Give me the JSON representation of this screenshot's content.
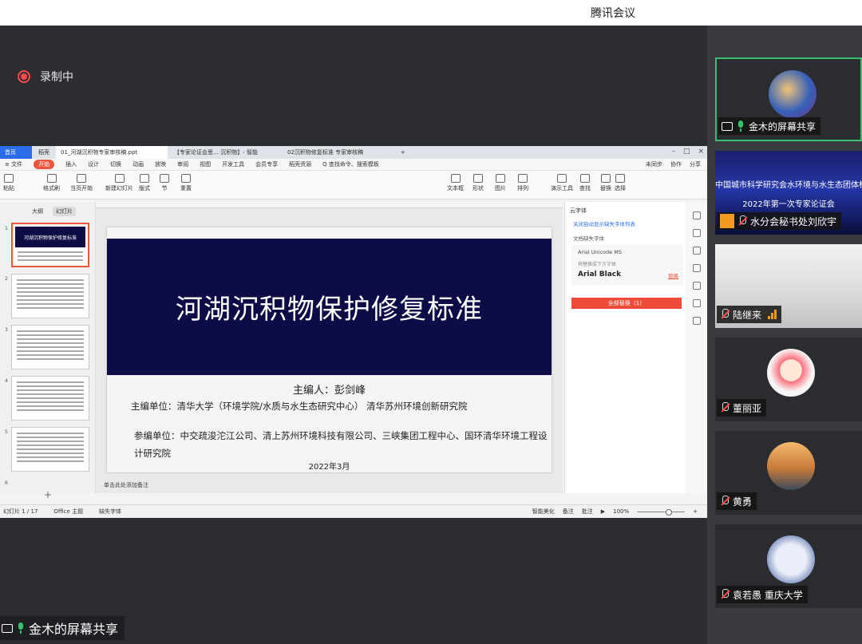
{
  "app": {
    "title": "腾讯会议",
    "recording": "录制中"
  },
  "wps": {
    "tabs": [
      "首页",
      "稻壳",
      "01_河湖沉积物专家审核稿.ppt",
      "【专家论证会思… 沉积物】- 智能",
      "02沉积物修复标准 专家审核稿"
    ],
    "menu": [
      "≡ 文件",
      "开始",
      "插入",
      "设计",
      "切换",
      "动画",
      "放映",
      "审阅",
      "视图",
      "开发工具",
      "会员专享",
      "稻壳资源",
      "Q 查找命令、搜索模板"
    ],
    "menu_right": [
      "未同步",
      "协作",
      "分享"
    ],
    "ribbon": [
      "粘贴",
      "格式刷",
      "当页开始",
      "新建幻灯片",
      "版式",
      "节",
      "重置",
      "文本框",
      "形状",
      "图片",
      "排列",
      "查找",
      "演示工具",
      "替换",
      "选择"
    ],
    "thumb_tabs": [
      "大纲",
      "幻灯片"
    ],
    "thumb_title": "河湖沉积物保护修复标准",
    "slide": {
      "title": "河湖沉积物保护修复标准",
      "editor": "主编人：彭剑峰",
      "org": "主编单位：清华大学（环境学院/水质与水生态研究中心）  清华苏州环境创新研究院",
      "participants": "参编单位：中交疏浚沱江公司、清上苏州环境科技有限公司、三峡集团工程中心、国环清华环境工程设计研究院",
      "date": "2022年3月"
    },
    "notes": "单击此处添加备注",
    "font_pane": {
      "title": "云字体",
      "link": "关闭自动显示缺失字体列表",
      "sub": "文档缺失字体",
      "missing": "Arial Unicode MS",
      "note": "将替换成下方字体",
      "font": "Arial Black",
      "install": "替换",
      "button": "全部替换（1）"
    },
    "status": {
      "slide": "幻灯片 1 / 17",
      "theme": "Office 主题",
      "missing_font": "缺失字体",
      "beautify": "智能美化",
      "notes": "备注",
      "comments": "批注",
      "zoom": "100%"
    }
  },
  "presenter_bottom": "金木的屏幕共享",
  "participants": [
    {
      "name": "金木的屏幕共享"
    },
    {
      "name": "水分会秘书处刘欣宇",
      "banner_line1": "中国城市科学研究会水环境与水生态团体标准",
      "banner_line2": "2022年第一次专家论证会"
    },
    {
      "name": "陆继来"
    },
    {
      "name": "董丽亚"
    },
    {
      "name": "黄勇"
    },
    {
      "name": "袁若愚 重庆大学"
    }
  ],
  "colors": {
    "accent_green": "#32c36c",
    "record_red": "#ff4b4b",
    "wps_red": "#e8563b",
    "slide_navy": "#0d0c46"
  }
}
